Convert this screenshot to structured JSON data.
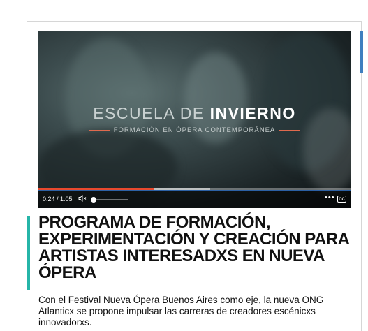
{
  "video": {
    "overlay_title_light": "ESCUELA DE",
    "overlay_title_bold": "INVIERNO",
    "overlay_subtitle": "FORMACIÓN EN ÓPERA CONTEMPORÁNEA",
    "current_time": "0:24",
    "duration": "1:05",
    "time_display": "0:24 / 1:05",
    "progress_fraction": 0.37,
    "buffered_fraction": 0.55,
    "volume_fraction": 0.0,
    "volume_icon": "speaker-muted-icon",
    "more_icon": "more-options-icon",
    "captions_icon": "closed-captions-icon",
    "captions_label": "CC",
    "accent_color": "#e8492e"
  },
  "article": {
    "headline": "PROGRAMA DE FORMACIÓN, EXPERIMENTACIÓN Y CREACIÓN PARA ARTISTAS INTERESADXS EN NUEVA ÓPERA",
    "lede": "Con el Festival Nueva Ópera Buenos Aires como eje, la nueva ONG Atlanticx se propone impulsar las carreras de creadores escénicxs innovadorxs.",
    "accent_color": "#26b5a8"
  }
}
